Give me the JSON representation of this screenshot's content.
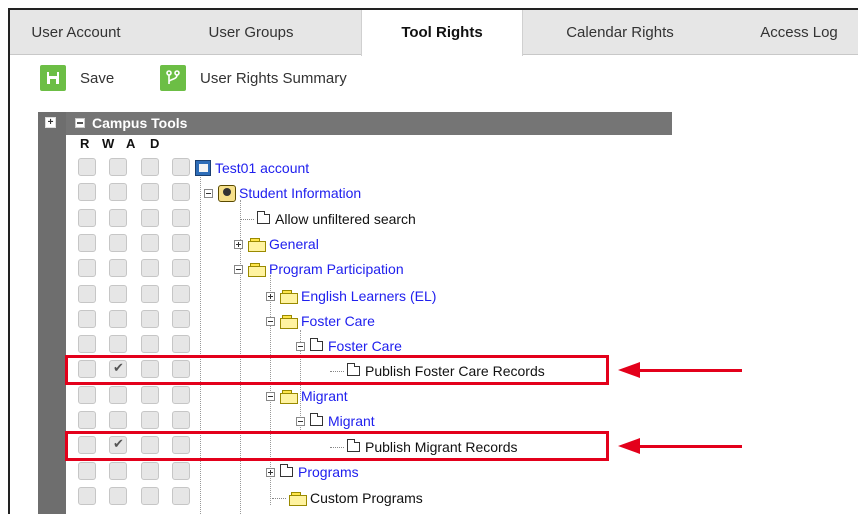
{
  "tabs": [
    {
      "label": "User Account",
      "active": false
    },
    {
      "label": "User Groups",
      "active": false
    },
    {
      "label": "Tool Rights",
      "active": true
    },
    {
      "label": "Calendar Rights",
      "active": false
    },
    {
      "label": "Access Log",
      "active": false
    }
  ],
  "toolbar": {
    "save_label": "Save",
    "summary_label": "User Rights Summary",
    "save_icon": "save-disk-icon",
    "summary_icon": "branch-icon",
    "accent_color": "#6cbe45"
  },
  "panel": {
    "title": "Campus Tools",
    "columns": [
      "R",
      "W",
      "A",
      "D"
    ],
    "header_color": "#757575"
  },
  "tree": [
    {
      "label": "Test01 account",
      "icon": "account-icon",
      "link": true,
      "checked": [
        false,
        false,
        false,
        false
      ]
    },
    {
      "label": "Student Information",
      "icon": "person-icon",
      "link": true,
      "expander": "minus",
      "checked": [
        false,
        false,
        false,
        false
      ]
    },
    {
      "label": "Allow unfiltered search",
      "icon": "document-icon",
      "link": false,
      "checked": [
        false,
        false,
        false,
        false
      ]
    },
    {
      "label": "General",
      "icon": "folder-icon",
      "link": true,
      "expander": "plus",
      "checked": [
        false,
        false,
        false,
        false
      ]
    },
    {
      "label": "Program Participation",
      "icon": "folder-icon",
      "link": true,
      "expander": "minus",
      "checked": [
        false,
        false,
        false,
        false
      ]
    },
    {
      "label": "English Learners (EL)",
      "icon": "folder-icon",
      "link": true,
      "expander": "plus",
      "checked": [
        false,
        false,
        false,
        false
      ]
    },
    {
      "label": "Foster Care",
      "icon": "folder-icon",
      "link": true,
      "expander": "minus",
      "checked": [
        false,
        false,
        false,
        false
      ]
    },
    {
      "label": "Foster Care",
      "icon": "document-icon",
      "link": true,
      "expander": "minus",
      "checked": [
        false,
        false,
        false,
        false
      ]
    },
    {
      "label": "Publish Foster Care Records",
      "icon": "document-icon",
      "link": false,
      "highlighted": true,
      "checked": [
        false,
        true,
        false,
        false
      ]
    },
    {
      "label": "Migrant",
      "icon": "folder-icon",
      "link": true,
      "expander": "minus",
      "checked": [
        false,
        false,
        false,
        false
      ]
    },
    {
      "label": "Migrant",
      "icon": "document-icon",
      "link": true,
      "expander": "minus",
      "checked": [
        false,
        false,
        false,
        false
      ]
    },
    {
      "label": "Publish Migrant Records",
      "icon": "document-icon",
      "link": false,
      "highlighted": true,
      "checked": [
        false,
        true,
        false,
        false
      ]
    },
    {
      "label": "Programs",
      "icon": "document-icon",
      "link": true,
      "expander": "plus",
      "checked": [
        false,
        false,
        false,
        false
      ]
    },
    {
      "label": "Custom Programs",
      "icon": "folder-icon",
      "link": false,
      "checked": [
        false,
        false,
        false,
        false
      ]
    }
  ],
  "annotation_color": "#e3001b"
}
